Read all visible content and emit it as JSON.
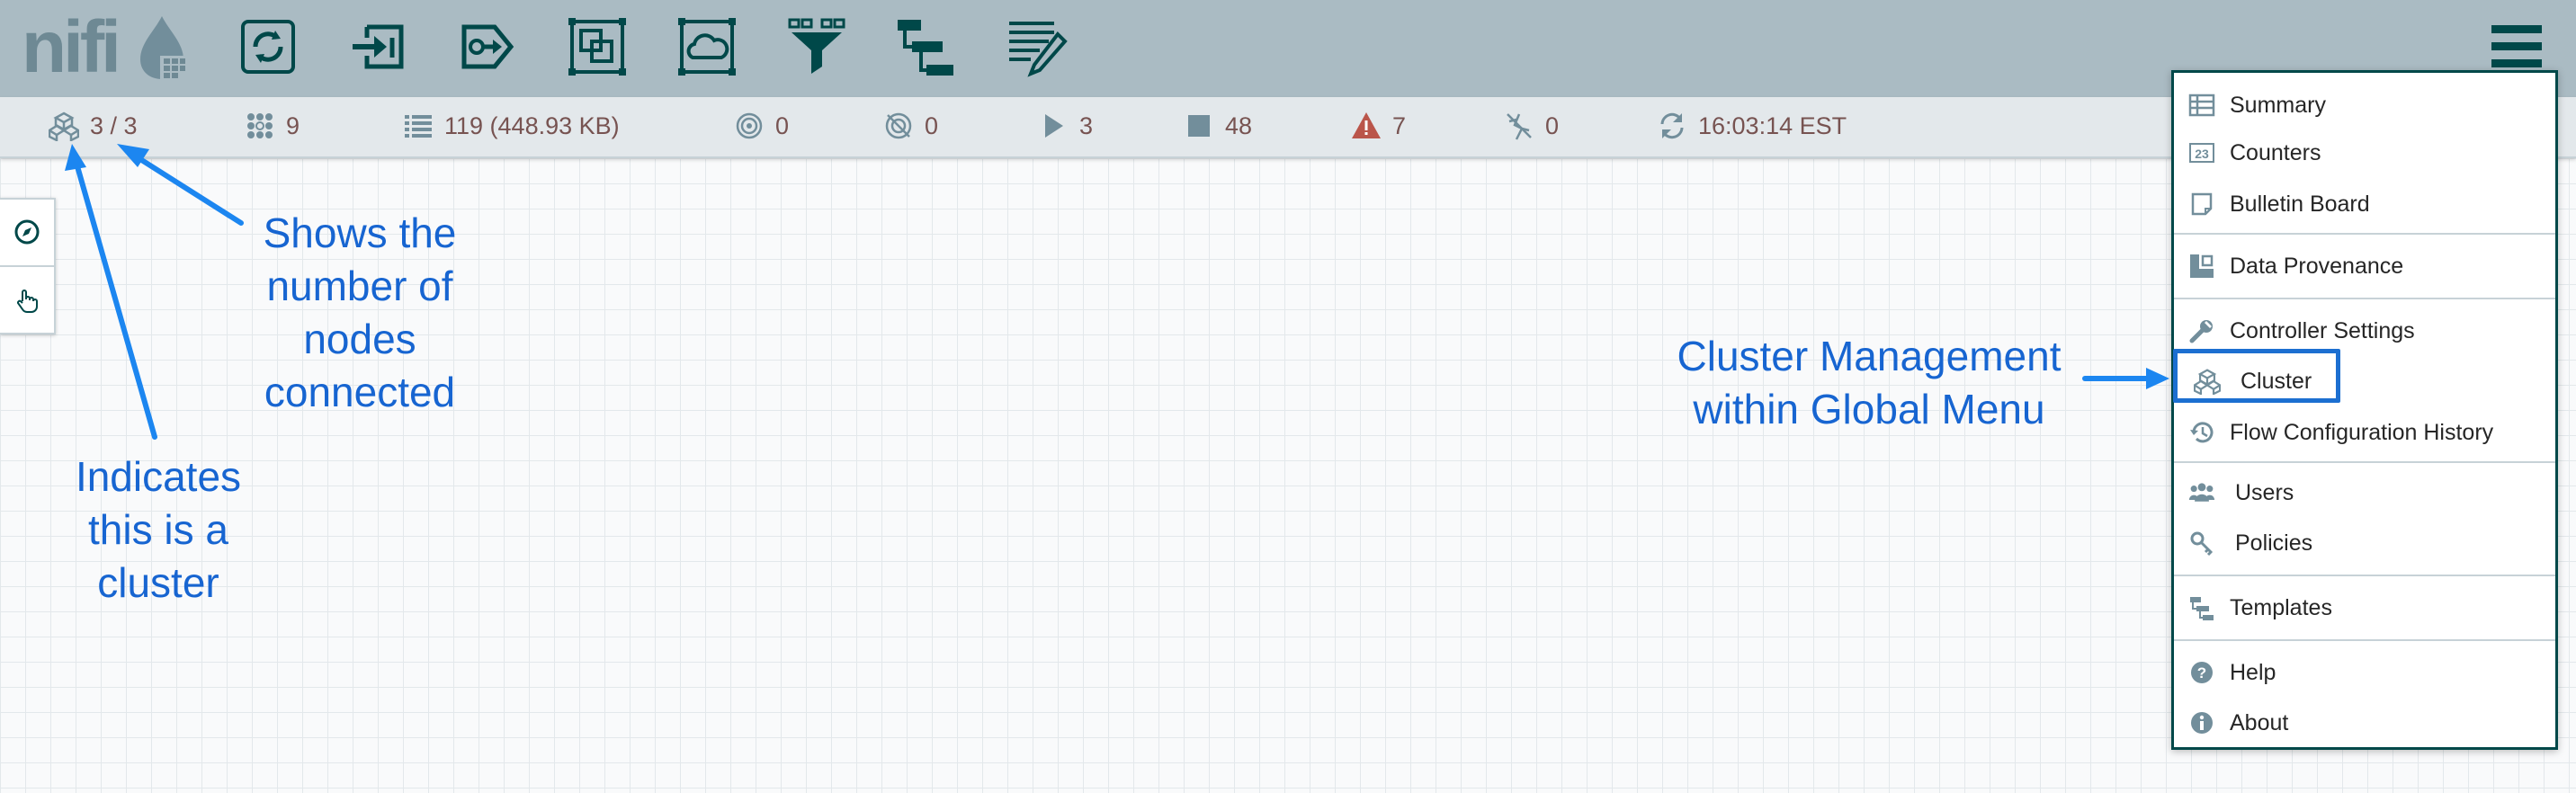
{
  "app": {
    "logo_text": "nifi"
  },
  "colors": {
    "header_bg": "#aabbc3",
    "statusbar_bg": "#e3e8eb",
    "icon_teal": "#004849",
    "status_text": "#775351",
    "warning_red": "#ba554a",
    "annotation_blue": "#1765d1"
  },
  "toolbar": {
    "items": [
      {
        "icon": "processor-icon"
      },
      {
        "icon": "input-port-icon"
      },
      {
        "icon": "output-port-icon"
      },
      {
        "icon": "process-group-icon"
      },
      {
        "icon": "remote-process-group-icon"
      },
      {
        "icon": "funnel-icon"
      },
      {
        "icon": "template-icon"
      },
      {
        "icon": "label-icon"
      }
    ],
    "menu_icon": "hamburger-menu-icon"
  },
  "status_bar": {
    "cluster_nodes": "3 / 3",
    "threads": "9",
    "queued": "119 (448.93 KB)",
    "transmitting": "0",
    "not_transmitting": "0",
    "running": "3",
    "stopped": "48",
    "invalid": "7",
    "disabled": "0",
    "refresh_time": "16:03:14 EST"
  },
  "global_menu": {
    "items": [
      {
        "label": "Summary",
        "icon": "table-icon"
      },
      {
        "label": "Counters",
        "icon": "counters-icon"
      },
      {
        "label": "Bulletin Board",
        "icon": "sticky-note-icon"
      },
      {
        "label": "Data Provenance",
        "icon": "provenance-icon"
      },
      {
        "label": "Controller Settings",
        "icon": "wrench-icon"
      },
      {
        "label": "Cluster",
        "icon": "cluster-icon"
      },
      {
        "label": "Flow Configuration History",
        "icon": "history-icon"
      },
      {
        "label": "Users",
        "icon": "users-icon"
      },
      {
        "label": "Policies",
        "icon": "key-icon"
      },
      {
        "label": "Templates",
        "icon": "templates-icon"
      },
      {
        "label": "Help",
        "icon": "question-icon"
      },
      {
        "label": "About",
        "icon": "info-icon"
      }
    ]
  },
  "annotations": {
    "nodes_connected": [
      "Shows the",
      "number of",
      "nodes",
      "connected"
    ],
    "is_cluster": [
      "Indicates",
      "this is a",
      "cluster"
    ],
    "cluster_menu": [
      "Cluster Management",
      "within Global Menu"
    ]
  }
}
